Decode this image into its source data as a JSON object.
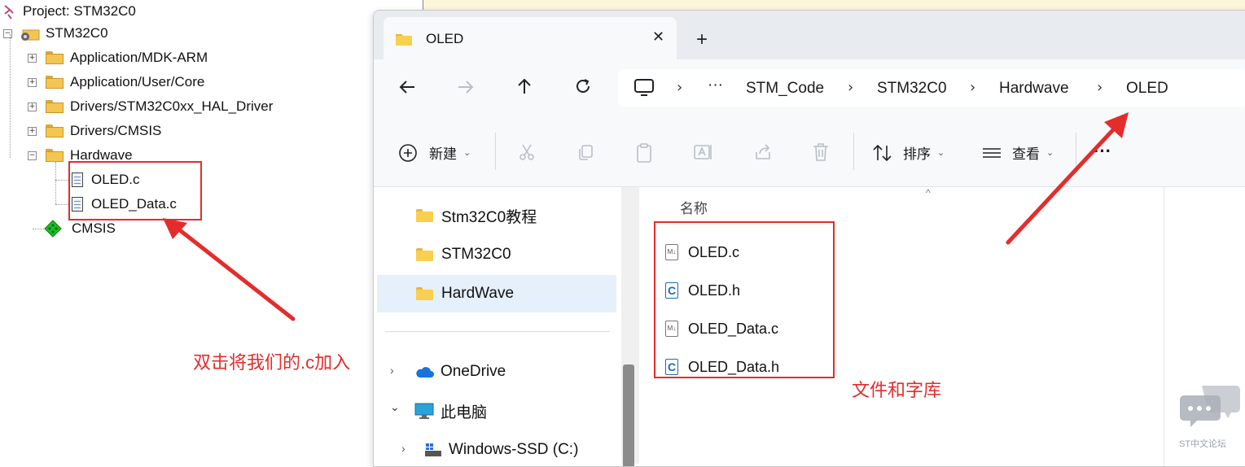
{
  "project_tree": {
    "project_title": "Project: STM32C0",
    "target": "STM32C0",
    "groups": [
      {
        "label": "Application/MDK-ARM"
      },
      {
        "label": "Application/User/Core"
      },
      {
        "label": "Drivers/STM32C0xx_HAL_Driver"
      },
      {
        "label": "Drivers/CMSIS"
      },
      {
        "label": "Hardwave"
      }
    ],
    "hardwave_files": [
      {
        "label": "OLED.c"
      },
      {
        "label": "OLED_Data.c"
      }
    ],
    "cmsis": "CMSIS"
  },
  "explorer": {
    "tab_title": "OLED",
    "close_glyph": "✕",
    "new_tab_glyph": "+",
    "breadcrumb": [
      {
        "label": "STM_Code"
      },
      {
        "label": "STM32C0"
      },
      {
        "label": "Hardwave"
      },
      {
        "label": "OLED"
      }
    ],
    "ellipsis": "···",
    "toolbar": {
      "new_label": "新建",
      "sort_label": "排序",
      "view_label": "查看",
      "more_label": "···"
    },
    "nav_items": [
      {
        "label": "Stm32C0教程"
      },
      {
        "label": "STM32C0"
      },
      {
        "label": "HardWave"
      }
    ],
    "nav_onedrive": "OneDrive",
    "nav_thispc": "此电脑",
    "nav_drive": "Windows-SSD (C:)",
    "column_header": "名称",
    "files": [
      {
        "name": "OLED.c",
        "icon": "source-c-file-icon"
      },
      {
        "name": "OLED.h",
        "icon": "header-c-file-icon"
      },
      {
        "name": "OLED_Data.c",
        "icon": "source-c-file-icon"
      },
      {
        "name": "OLED_Data.h",
        "icon": "header-c-file-icon"
      }
    ]
  },
  "annotations": {
    "add_hint": "双击将我们的.c加入",
    "files_hint": "文件和字库",
    "color": "#e42c2c"
  },
  "watermark": "ST中文论坛"
}
